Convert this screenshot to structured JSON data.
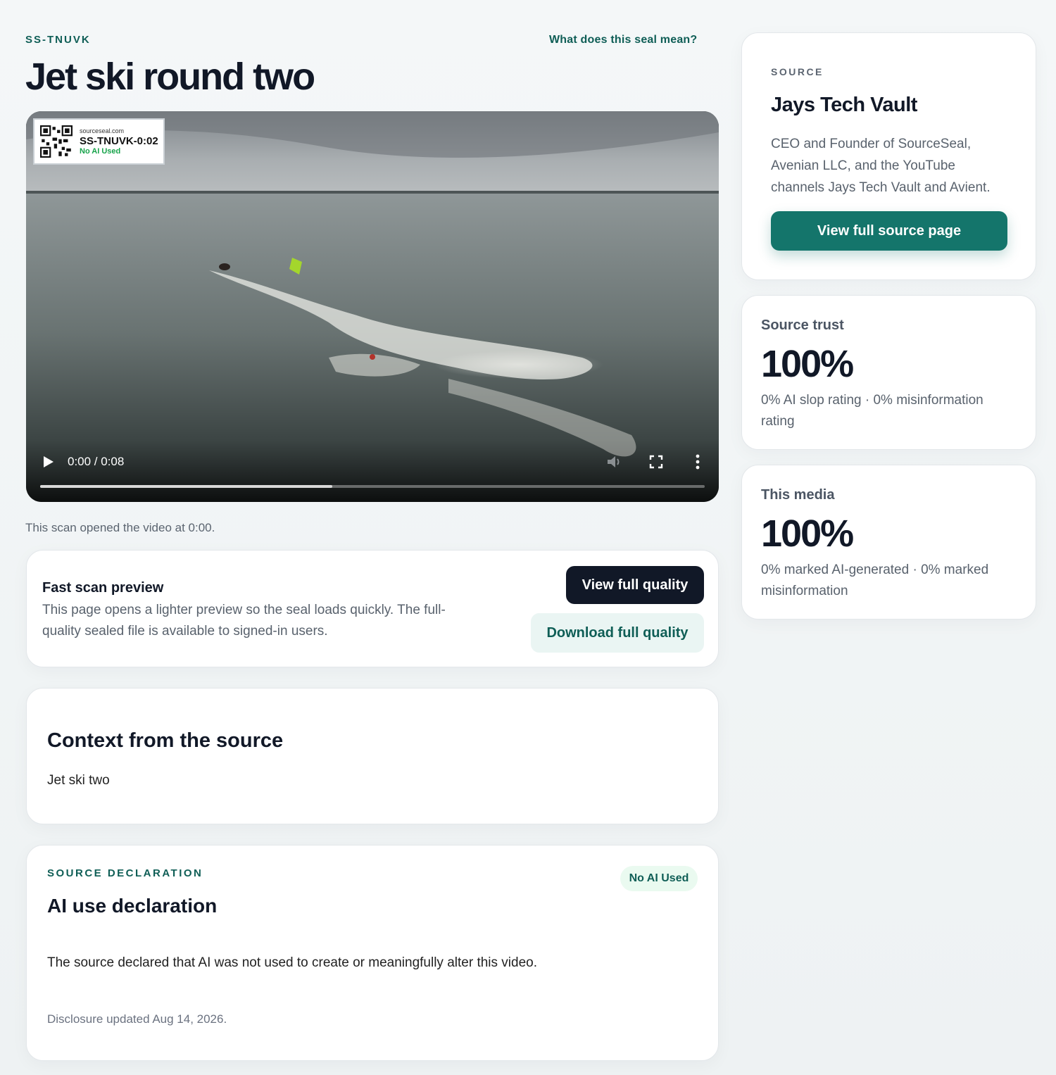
{
  "header": {
    "seal_id": "SS-TNUVK",
    "seal_help_link": "What does this seal mean?",
    "title": "Jet ski round two"
  },
  "video": {
    "overlay": {
      "domain": "sourceseal.com",
      "code": "SS-TNUVK-0:02",
      "tag": "No AI Used"
    },
    "time_display": "0:00 / 0:08",
    "progress_fraction": 0.44,
    "icons": {
      "play": "play-icon",
      "volume": "volume-icon",
      "fullscreen": "fullscreen-icon",
      "more": "more-vertical-icon"
    }
  },
  "scan_note": "This scan opened the video at 0:00.",
  "preview_card": {
    "title": "Fast scan preview",
    "body": "This page opens a lighter preview so the seal loads quickly. The full-quality sealed file is available to signed-in users.",
    "view_button": "View full quality",
    "download_button": "Download full quality"
  },
  "context_card": {
    "title": "Context from the source",
    "body": "Jet ski two"
  },
  "declaration_card": {
    "kicker": "SOURCE DECLARATION",
    "title": "AI use declaration",
    "badge": "No AI Used",
    "body": "The source declared that AI was not used to create or meaningfully alter this video.",
    "updated": "Disclosure updated Aug 14, 2026."
  },
  "source_card": {
    "kicker": "SOURCE",
    "name": "Jays Tech Vault",
    "bio": "CEO and Founder of SourceSeal, Avenian LLC, and the YouTube channels Jays Tech Vault and Avient.",
    "button": "View full source page"
  },
  "trust_card": {
    "label": "Source trust",
    "value": "100%",
    "note": "0% AI slop rating · 0% misinformation rating"
  },
  "media_card": {
    "label": "This media",
    "value": "100%",
    "note": "0% marked AI-generated · 0% marked misinformation"
  },
  "colors": {
    "accent": "#0f5e56",
    "accent_button": "#14756b",
    "dark_button": "#111827"
  }
}
